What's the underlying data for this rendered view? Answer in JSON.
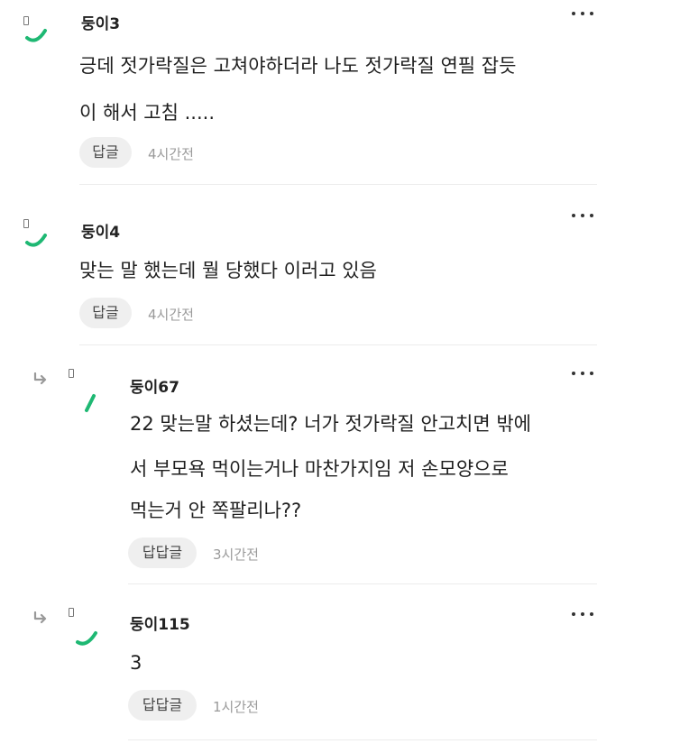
{
  "comments": [
    {
      "author": "둥이3",
      "lines": [
        "긍데 젓가락질은 고쳐야하더라 나도 젓가락질 연필 잡듯",
        "이 해서 고침 ....."
      ],
      "reply_label": "답글",
      "time": "4시간전"
    },
    {
      "author": "둥이4",
      "lines": [
        "맞는 말 했는데 뭘 당했다 이러고 있음"
      ],
      "reply_label": "답글",
      "time": "4시간전"
    },
    {
      "author": "둥이67",
      "lines": [
        "22 맞는말 하셨는데? 너가 젓가락질 안고치면 밖에",
        "서 부모욕 먹이는거나 마찬가지임 저 손모양으로",
        "먹는거 안 쪽팔리나??"
      ],
      "reply_label": "답답글",
      "time": "3시간전"
    },
    {
      "author": "둥이115",
      "lines": [
        "3"
      ],
      "reply_label": "답답글",
      "time": "1시간전"
    }
  ],
  "colors": {
    "avatar_stroke": "#1eb873",
    "reply_bg": "#efefef",
    "time": "#9a9a9a"
  },
  "icons": {
    "more": "more-vertical-dots-icon",
    "reply": "reply-arrow-icon",
    "avatar": "profile-avatar-icon"
  }
}
